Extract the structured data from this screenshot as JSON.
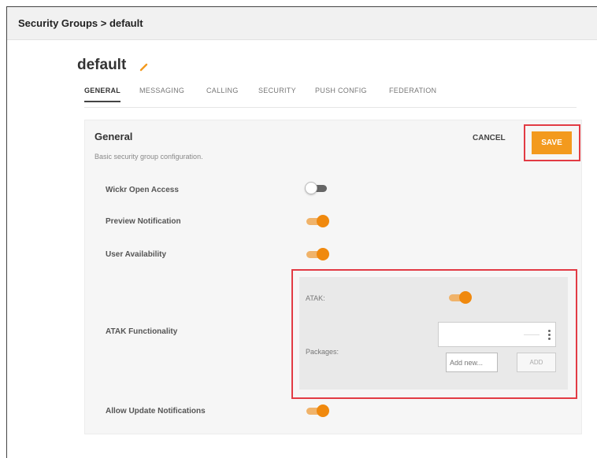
{
  "breadcrumb": "Security Groups > default",
  "page_title": "default",
  "tabs": [
    {
      "label": "GENERAL",
      "active": true
    },
    {
      "label": "MESSAGING",
      "active": false
    },
    {
      "label": "CALLING",
      "active": false
    },
    {
      "label": "SECURITY",
      "active": false
    },
    {
      "label": "PUSH CONFIG",
      "active": false
    },
    {
      "label": "FEDERATION",
      "active": false
    }
  ],
  "card": {
    "title": "General",
    "subtitle": "Basic security group configuration.",
    "cancel_label": "CANCEL",
    "save_label": "SAVE"
  },
  "settings": [
    {
      "label": "Wickr Open Access",
      "enabled": false
    },
    {
      "label": "Preview Notification",
      "enabled": true
    },
    {
      "label": "User Availability",
      "enabled": true
    },
    {
      "label": "ATAK Functionality"
    },
    {
      "label": "Allow Update Notifications",
      "enabled": true
    }
  ],
  "atak": {
    "atak_label": "ATAK:",
    "atak_enabled": true,
    "packages_label": "Packages:",
    "add_placeholder": "Add new...",
    "add_button": "ADD"
  },
  "colors": {
    "accent": "#f39a1e",
    "toggle_on": "#f0890e",
    "highlight": "#e23b44"
  }
}
